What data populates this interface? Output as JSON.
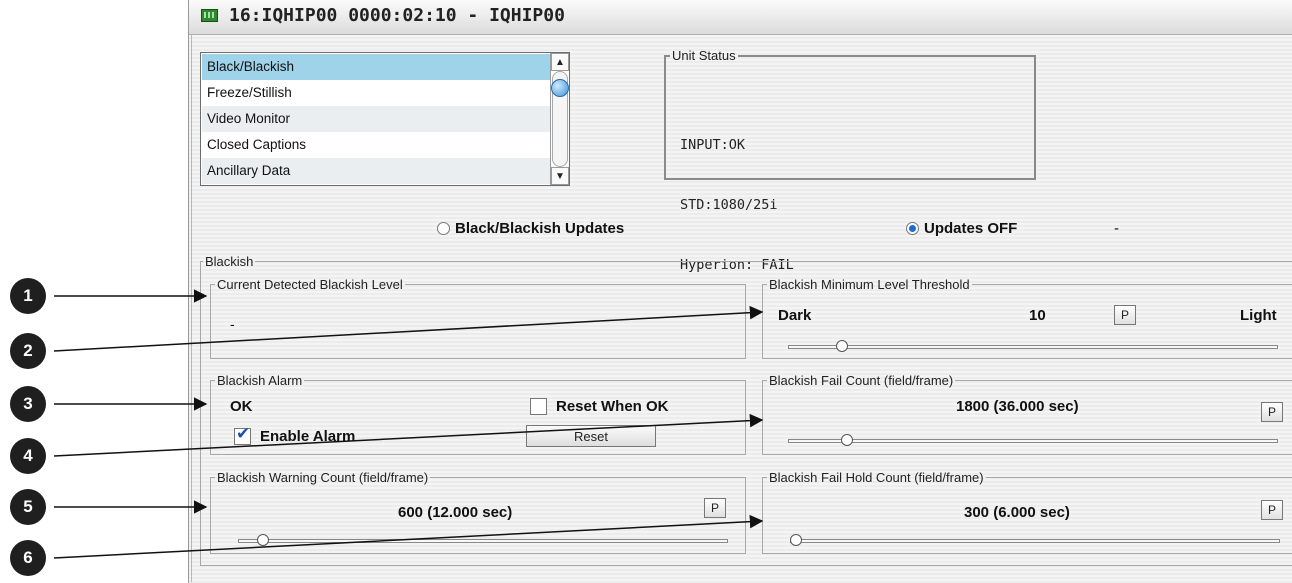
{
  "window": {
    "title": "16:IQHIP00  0000:02:10  - IQHIP00",
    "icon": "monitor-icon"
  },
  "list": {
    "items": [
      {
        "label": "Black/Blackish",
        "selected": true
      },
      {
        "label": "Freeze/Stillish",
        "selected": false
      },
      {
        "label": "Video Monitor",
        "selected": false
      },
      {
        "label": "Closed Captions",
        "selected": false
      },
      {
        "label": "Ancillary Data",
        "selected": false
      }
    ]
  },
  "unit_status": {
    "legend": "Unit Status",
    "lines": [
      "INPUT:OK",
      "STD:1080/25i",
      "Hyperion: FAIL"
    ]
  },
  "updates": {
    "option1": "Black/Blackish Updates",
    "option2": "Updates OFF",
    "selected": "Updates OFF",
    "value": "-"
  },
  "blackish": {
    "legend": "Blackish",
    "current_level": {
      "legend": "Current Detected Blackish Level",
      "value": "-"
    },
    "min_threshold": {
      "legend": "Blackish Minimum Level Threshold",
      "left_label": "Dark",
      "value": "10",
      "right_label": "Light",
      "p_label": "P",
      "slider_fraction": 0.1
    },
    "alarm": {
      "legend": "Blackish Alarm",
      "status": "OK",
      "reset_when_ok_label": "Reset When OK",
      "reset_when_ok_checked": false,
      "enable_label": "Enable Alarm",
      "enable_checked": true,
      "reset_button": "Reset"
    },
    "fail_count": {
      "legend": "Blackish Fail Count (field/frame)",
      "value": "1800 (36.000 sec)",
      "p_label": "P",
      "slider_fraction": 0.11
    },
    "warning_count": {
      "legend": "Blackish Warning Count (field/frame)",
      "value": "600 (12.000 sec)",
      "p_label": "P",
      "slider_fraction": 0.04
    },
    "fail_hold_count": {
      "legend": "Blackish Fail Hold Count (field/frame)",
      "value": "300 (6.000 sec)",
      "p_label": "P",
      "slider_fraction": 0.0
    }
  },
  "callouts": [
    "1",
    "2",
    "3",
    "4",
    "5",
    "6"
  ],
  "colors": {
    "selected_item": "#9fd3ea",
    "radio_on": "#1e6ad3",
    "callout": "#1f1f1f",
    "checkmark": "#1d4fb0"
  }
}
